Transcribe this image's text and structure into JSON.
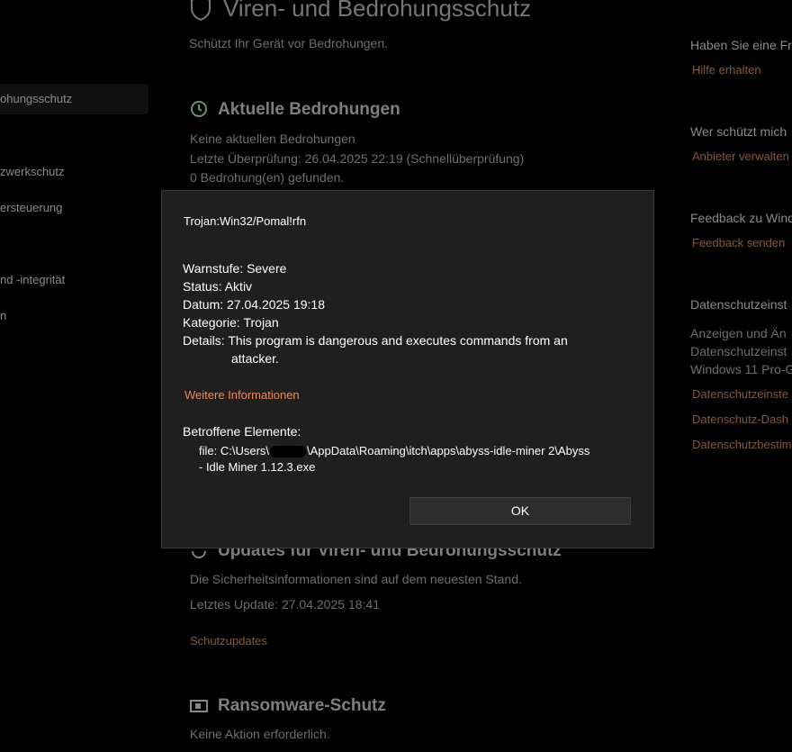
{
  "page": {
    "title": "Viren- und Bedrohungsschutz",
    "subtitle": "Schützt Ihr Gerät vor Bedrohungen."
  },
  "sidebar": {
    "items": [
      {
        "label": "ohungsschutz",
        "selected": true
      },
      {
        "label": "zwerkschutz"
      },
      {
        "label": "ersteuerung"
      },
      {
        "label": "nd -integrität"
      },
      {
        "label": "n"
      }
    ]
  },
  "threats": {
    "title": "Aktuelle Bedrohungen",
    "line1": "Keine aktuellen Bedrohungen",
    "line2": "Letzte Überprüfung: 26.04.2025 22:19 (Schnellüberprüfung)",
    "line3": "0 Bedrohung(en) gefunden."
  },
  "updates": {
    "title": "Updates für Viren- und Bedrohungsschutz",
    "line1": "Die Sicherheitsinformationen sind auf dem neuesten Stand.",
    "line2": "Letztes Update: 27.04.2025 18:41",
    "link": "Schutzupdates"
  },
  "ransomware": {
    "title": "Ransomware-Schutz",
    "line1": "Keine Aktion erforderlich."
  },
  "right_panel": {
    "help_head": "Haben Sie eine Fr",
    "help_link": "Hilfe erhalten",
    "who_head": "Wer schützt mich",
    "who_link": "Anbieter verwalten",
    "feedback_head": "Feedback zu Wind",
    "feedback_link": "Feedback senden",
    "privacy_head": "Datenschutzeinst",
    "privacy_text1": "Anzeigen und Än",
    "privacy_text2": "Datenschutzeinst",
    "privacy_text3": "Windows 11 Pro-G",
    "privacy_link1": "Datenschutzeinste",
    "privacy_link2": "Datenschutz-Dash",
    "privacy_link3": "Datenschutzbestim"
  },
  "dialog": {
    "threat_name": "Trojan:Win32/Pomal!rfn",
    "severity_label": "Warnstufe:",
    "severity_value": "Severe",
    "status_label": "Status:",
    "status_value": "Aktiv",
    "date_label": "Datum:",
    "date_value": "27.04.2025 19:18",
    "category_label": "Kategorie:",
    "category_value": "Trojan",
    "details_label": "Details:",
    "details_line1": "This program is dangerous and executes commands from an",
    "details_line2": "attacker.",
    "more_info": "Weitere Informationen",
    "affected_label": "Betroffene Elemente:",
    "path_prefix": "file: C:\\Users\\",
    "path_suffix": "\\AppData\\Roaming\\itch\\apps\\abyss-idle-miner 2\\Abyss",
    "path_line2": "- Idle Miner 1.12.3.exe",
    "ok_label": "OK"
  },
  "colors": {
    "dialog_bg": "#1f1f1f",
    "link_accent": "#e88a5c"
  }
}
